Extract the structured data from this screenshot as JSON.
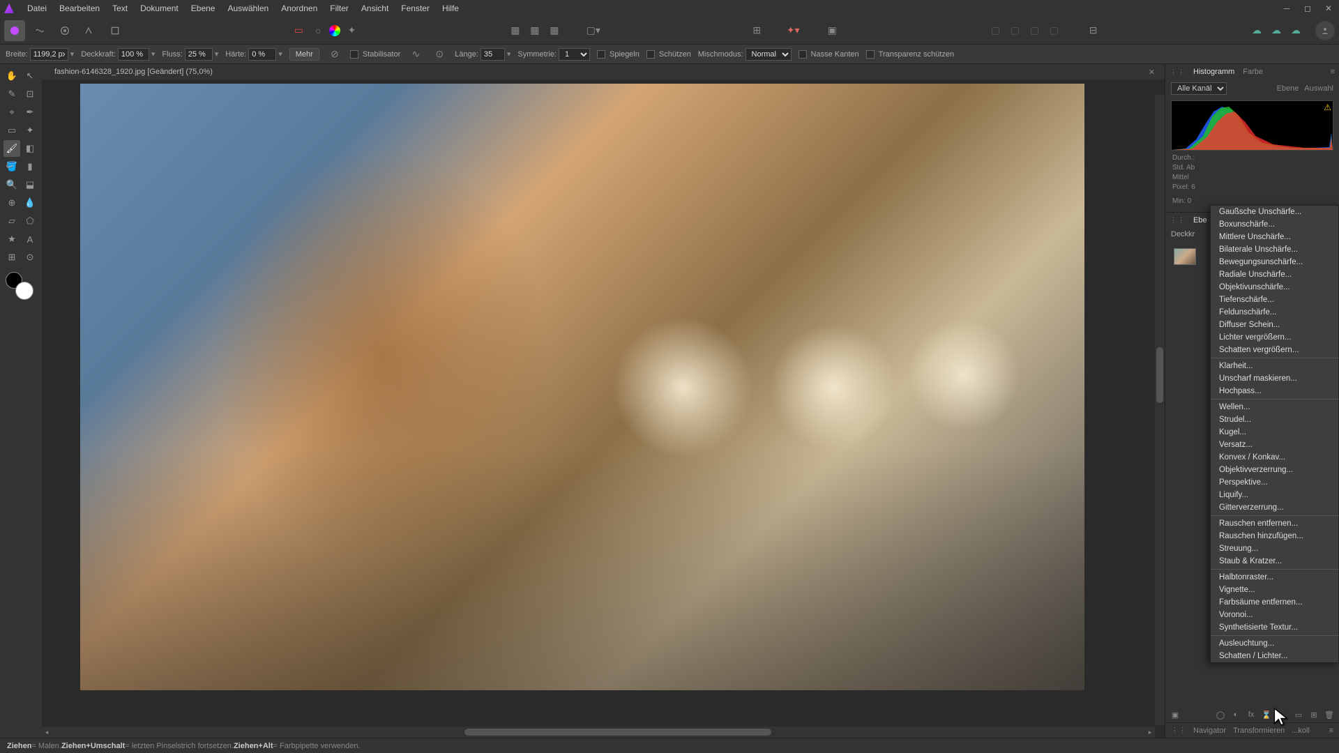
{
  "menubar": [
    "Datei",
    "Bearbeiten",
    "Text",
    "Dokument",
    "Ebene",
    "Auswählen",
    "Anordnen",
    "Filter",
    "Ansicht",
    "Fenster",
    "Hilfe"
  ],
  "context": {
    "breite_label": "Breite:",
    "breite_val": "1199,2 px",
    "deckkraft_label": "Deckkraft:",
    "deckkraft_val": "100 %",
    "fluss_label": "Fluss:",
    "fluss_val": "25 %",
    "haerte_label": "Härte:",
    "haerte_val": "0 %",
    "mehr": "Mehr",
    "stabilisator": "Stabilisator",
    "laenge_label": "Länge:",
    "laenge_val": "35",
    "symmetrie_label": "Symmetrie:",
    "symmetrie_val": "1",
    "spiegeln": "Spiegeln",
    "schuetzen": "Schützen",
    "mischmodus_label": "Mischmodus:",
    "mischmodus_val": "Normal",
    "nasse_kanten": "Nasse Kanten",
    "transparenz": "Transparenz schützen"
  },
  "doc_tab": "fashion-6146328_1920.jpg [Geändert] (75,0%)",
  "right": {
    "tab_histogramm": "Histogramm",
    "tab_farbe": "Farbe",
    "channel_sel": "Alle Kanäle",
    "opt_ebene": "Ebene",
    "opt_auswahl": "Auswahl",
    "stats": {
      "durch": "Durch.:",
      "std": "Std. Ab",
      "mittel": "Mittel",
      "pixel": "Pixel: 6",
      "min": "Min: 0"
    },
    "tab_ebenen": "Ebe",
    "deckkr": "Deckkr"
  },
  "filter_menu": {
    "group1": [
      "Gaußsche Unschärfe...",
      "Boxunschärfe...",
      "Mittlere Unschärfe...",
      "Bilaterale Unschärfe...",
      "Bewegungsunschärfe...",
      "Radiale Unschärfe...",
      "Objektivunschärfe...",
      "Tiefenschärfe...",
      "Feldunschärfe...",
      "Diffuser Schein...",
      "Lichter vergrößern...",
      "Schatten vergrößern..."
    ],
    "group2": [
      "Klarheit...",
      "Unscharf maskieren...",
      "Hochpass..."
    ],
    "group3": [
      "Wellen...",
      "Strudel...",
      "Kugel...",
      "Versatz...",
      "Konvex / Konkav...",
      "Objektivverzerrung...",
      "Perspektive...",
      "Liquify...",
      "Gitterverzerrung..."
    ],
    "group4": [
      "Rauschen entfernen...",
      "Rauschen hinzufügen...",
      "Streuung...",
      "Staub & Kratzer..."
    ],
    "group5": [
      "Halbtonraster...",
      "Vignette...",
      "Farbsäume entfernen...",
      "Voronoi...",
      "Synthetisierte Textur..."
    ],
    "group6": [
      "Ausleuchtung...",
      "Schatten / Lichter..."
    ]
  },
  "bottom_tabs": {
    "navigator": "Navigator",
    "transformieren": "Transformieren",
    "protokoll": "...koll"
  },
  "status": {
    "s1": "Ziehen",
    "s1t": " = Malen. ",
    "s2": "Ziehen+Umschalt",
    "s2t": " = letzten Pinselstrich fortsetzen. ",
    "s3": "Ziehen+Alt",
    "s3t": " = Farbpipette verwenden."
  },
  "chart_data": {
    "type": "histogram",
    "title": "Histogramm",
    "channels": [
      "R",
      "G",
      "B"
    ],
    "xlim": [
      0,
      255
    ],
    "note": "RGB luminosity histogram; peaks concentrated in lower-mid tones with small highlight spike at far right",
    "approx_bins": {
      "R": [
        0,
        0,
        2,
        5,
        10,
        22,
        40,
        55,
        60,
        50,
        35,
        20,
        10,
        5,
        3,
        2,
        1,
        1,
        1,
        1,
        1,
        1,
        1,
        0,
        0,
        0,
        0,
        0,
        0,
        0,
        0,
        8
      ],
      "G": [
        0,
        0,
        3,
        8,
        18,
        35,
        55,
        70,
        65,
        45,
        25,
        12,
        6,
        3,
        2,
        1,
        1,
        1,
        0,
        0,
        0,
        0,
        0,
        0,
        0,
        0,
        0,
        0,
        0,
        0,
        0,
        6
      ],
      "B": [
        0,
        0,
        5,
        12,
        28,
        48,
        62,
        58,
        40,
        22,
        12,
        6,
        3,
        2,
        1,
        1,
        0,
        0,
        0,
        0,
        0,
        0,
        0,
        0,
        0,
        0,
        0,
        0,
        0,
        0,
        0,
        5
      ]
    }
  }
}
